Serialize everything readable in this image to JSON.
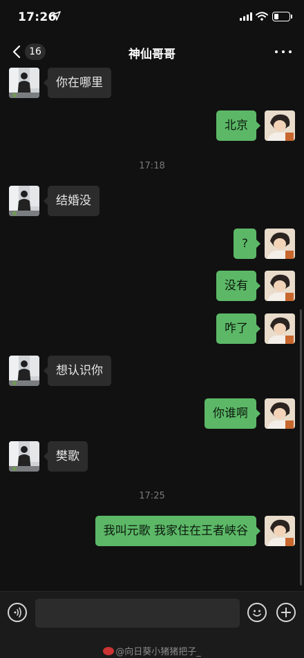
{
  "status_bar": {
    "time": "17:26",
    "location_icon": "location-arrow-icon",
    "signal_icon": "cellular-signal-icon",
    "wifi_icon": "wifi-icon",
    "battery_icon": "battery-icon",
    "battery_level": 0.25
  },
  "nav": {
    "back_icon": "chevron-left-icon",
    "unread_count": "16",
    "title": "神仙哥哥",
    "more_icon": "more-dots-icon"
  },
  "messages": [
    {
      "side": "left",
      "text": "你在哪里"
    },
    {
      "side": "right",
      "text": "北京"
    },
    {
      "type": "timestamp",
      "text": "17:18"
    },
    {
      "side": "left",
      "text": "结婚没"
    },
    {
      "side": "right",
      "text": "?"
    },
    {
      "side": "right",
      "text": "没有"
    },
    {
      "side": "right",
      "text": "咋了"
    },
    {
      "side": "left",
      "text": "想认识你"
    },
    {
      "side": "right",
      "text": "你谁啊"
    },
    {
      "side": "left",
      "text": "樊歌"
    },
    {
      "type": "timestamp",
      "text": "17:25"
    },
    {
      "side": "right",
      "text": "我叫元歌 我家住在王者峡谷"
    }
  ],
  "input_bar": {
    "voice_icon": "voice-input-icon",
    "text_value": "",
    "emoji_icon": "emoji-icon",
    "plus_icon": "plus-icon"
  },
  "watermark": "@向日葵小猪猪把子_",
  "colors": {
    "background": "#111111",
    "sent_bubble": "#5cb867",
    "received_bubble": "#2c2c2c",
    "timestamp": "#7a7a7a"
  }
}
